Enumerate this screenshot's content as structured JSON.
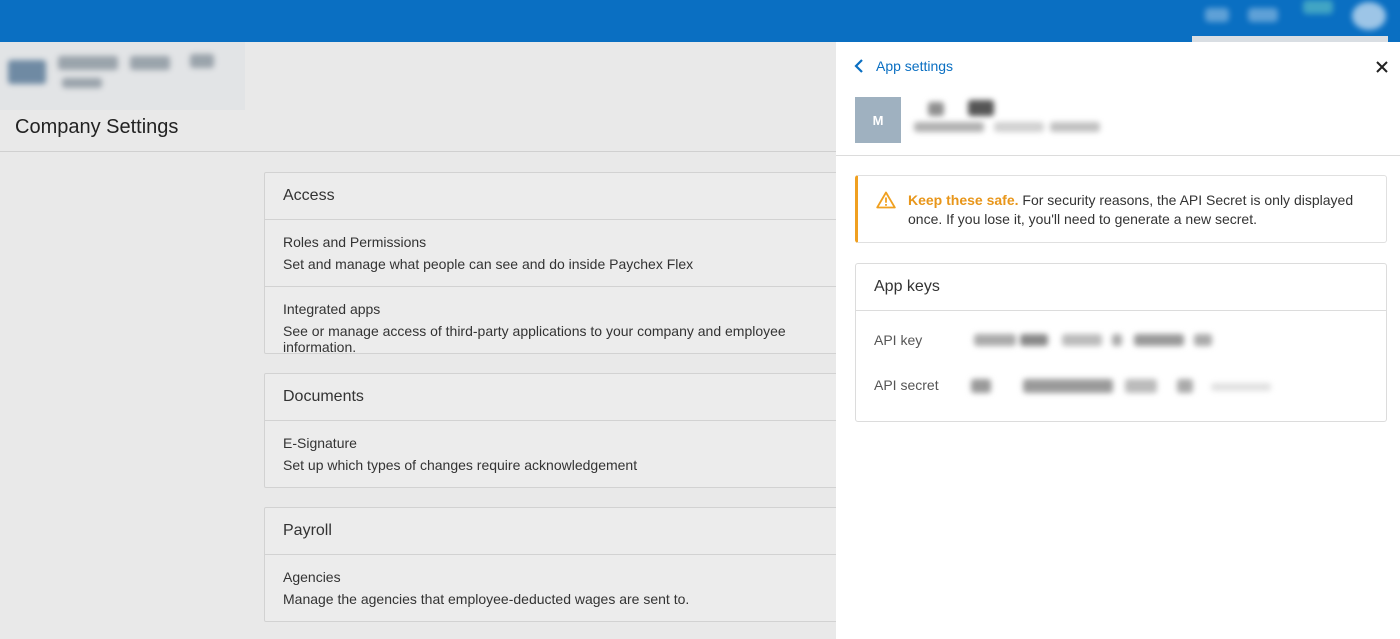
{
  "company_settings": {
    "page_title": "Company Settings",
    "sections": [
      {
        "header": "Access",
        "items": [
          {
            "title": "Roles and Permissions",
            "desc": "Set and manage what people can see and do inside Paychex Flex"
          },
          {
            "title": "Integrated apps",
            "desc": "See or manage access of third-party applications to your company and employee information."
          }
        ]
      },
      {
        "header": "Documents",
        "items": [
          {
            "title": "E-Signature",
            "desc": "Set up which types of changes require acknowledgement"
          }
        ]
      },
      {
        "header": "Payroll",
        "items": [
          {
            "title": "Agencies",
            "desc": "Manage the agencies that employee-deducted wages are sent to."
          }
        ]
      }
    ]
  },
  "panel": {
    "back_label": "App settings",
    "app_initial": "M",
    "alert": {
      "strong": "Keep these safe.",
      "text": " For security reasons, the API Secret is only displayed once. If you lose it, you'll need to generate a new secret."
    },
    "keys_card": {
      "title": "App keys",
      "api_key_label": "API key",
      "api_secret_label": "API secret"
    }
  },
  "colors": {
    "topbar": "#0a6fc2",
    "link": "#0a6fc2",
    "warning": "#f0a020",
    "avatar": "#9fb1c0"
  },
  "icons": {
    "back": "chevron-left-icon",
    "close": "close-icon",
    "alert": "warning-triangle-icon"
  }
}
